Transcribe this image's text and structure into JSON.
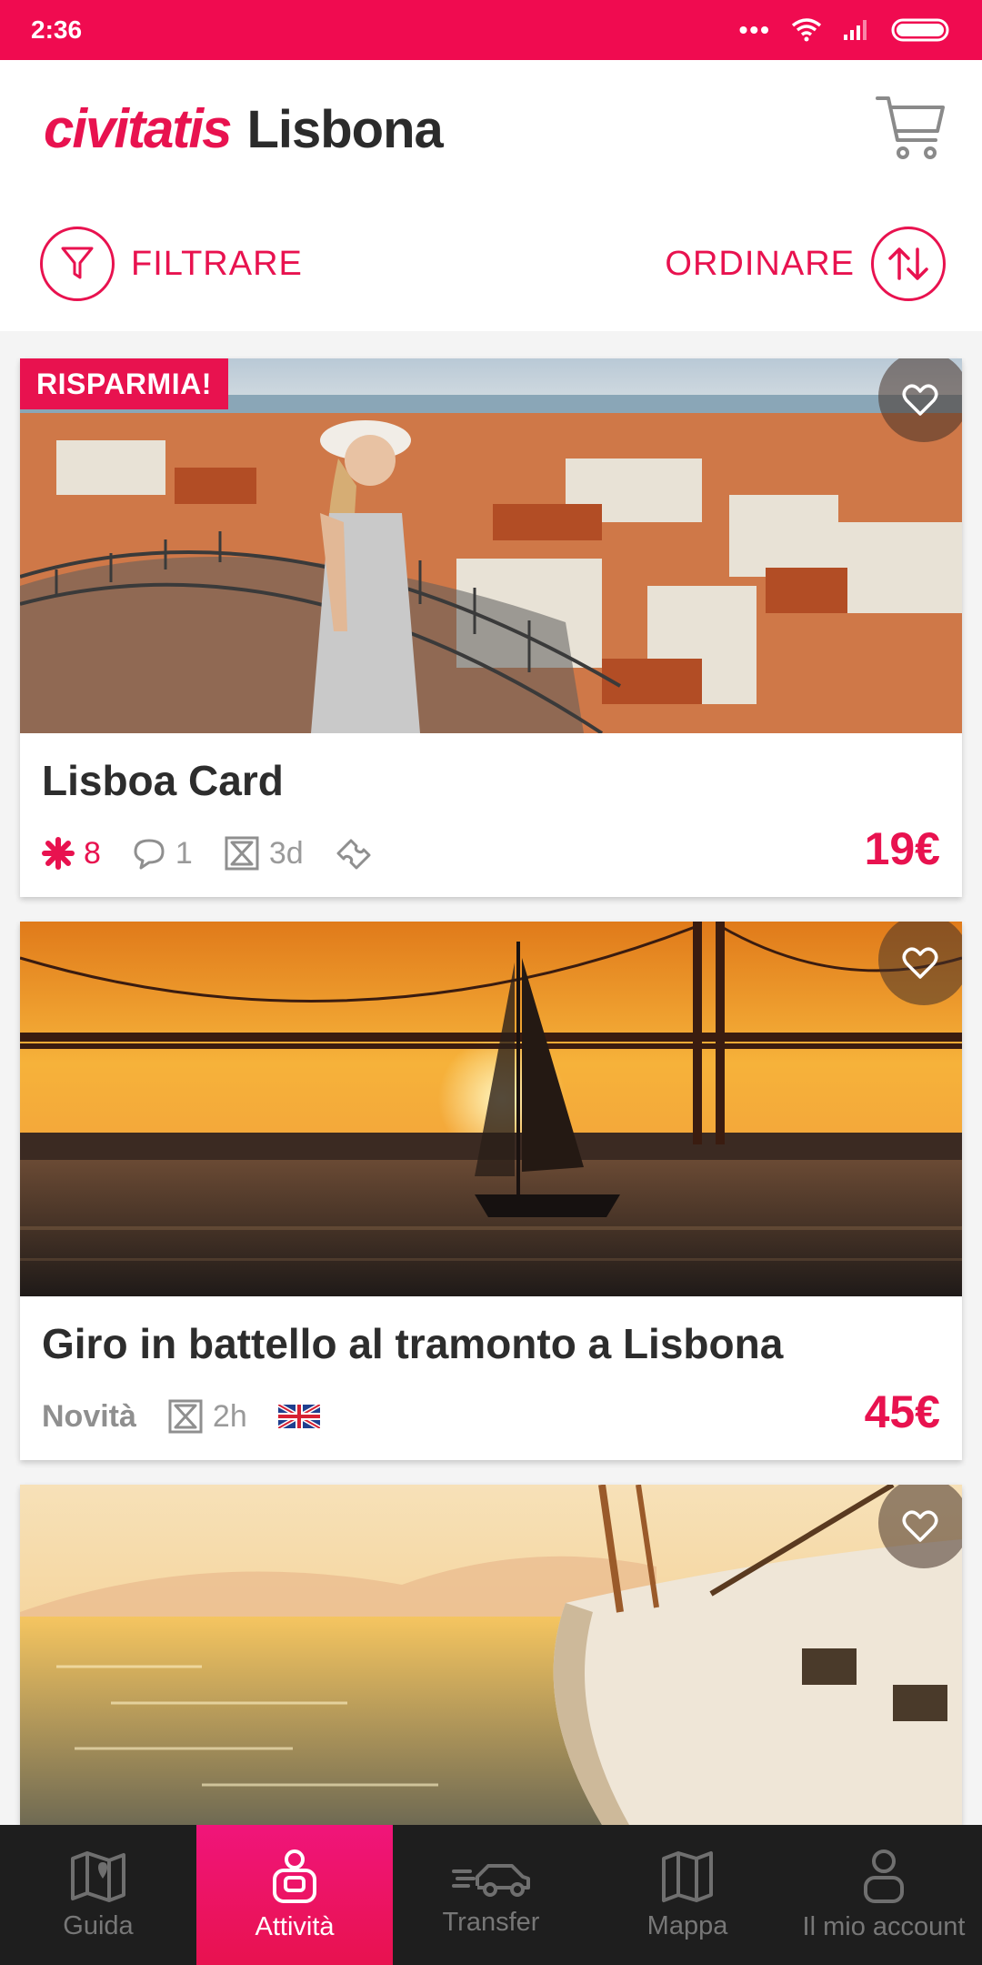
{
  "status_bar": {
    "time": "2:36"
  },
  "header": {
    "brand": "civitatis",
    "city": "Lisbona"
  },
  "toolbar": {
    "filter_label": "FILTRARE",
    "sort_label": "ORDINARE"
  },
  "cards": [
    {
      "badge": "RISPARMIA!",
      "title": "Lisboa Card",
      "rating": "8",
      "comments": "1",
      "duration": "3d",
      "price": "19€"
    },
    {
      "tag": "Novità",
      "title": "Giro in battello al tramonto a Lisbona",
      "duration": "2h",
      "price": "45€",
      "language_flag": "uk-flag-icon"
    },
    {
      "title": ""
    }
  ],
  "bottom_nav": {
    "active_index": 1,
    "items": [
      {
        "label": "Guida",
        "icon": "map-icon"
      },
      {
        "label": "Attività",
        "icon": "activities-icon"
      },
      {
        "label": "Transfer",
        "icon": "car-icon"
      },
      {
        "label": "Mappa",
        "icon": "map-fold-icon"
      },
      {
        "label": "Il mio account",
        "icon": "user-icon"
      }
    ]
  },
  "colors": {
    "accent": "#e8124f",
    "status_bar": "#f00b50",
    "nav_bg": "#1e1e1e"
  }
}
